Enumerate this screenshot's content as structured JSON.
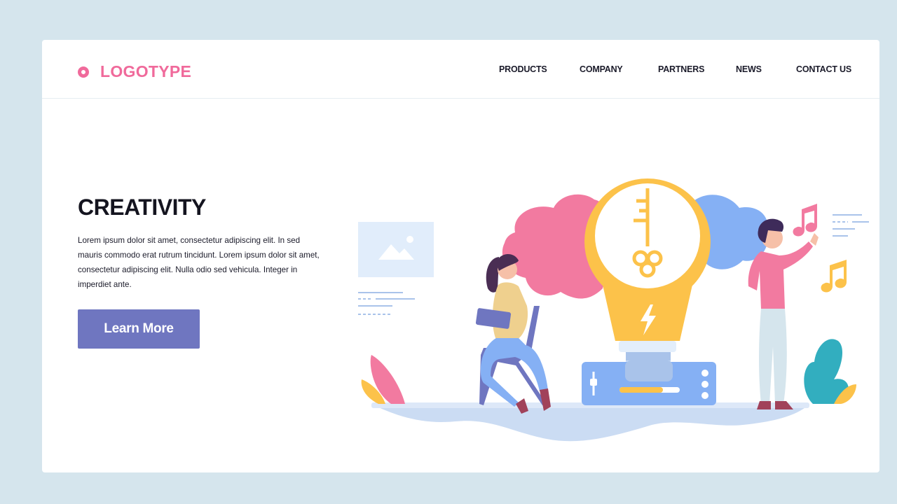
{
  "header": {
    "logo_text": "LOGOTYPE",
    "nav": [
      "PRODUCTS",
      "COMPANY",
      "PARTNERS",
      "NEWS",
      "CONTACT US"
    ]
  },
  "hero": {
    "title": "CREATIVITY",
    "body": "Lorem ipsum dolor sit amet, consectetur adipiscing elit. In sed mauris commodo erat rutrum tincidunt. Lorem ipsum dolor sit amet, consectetur adipiscing elit. Nulla  odio sed vehicula. Integer in imperdiet ante.",
    "cta_label": "Learn More"
  },
  "illustration": {
    "icons": [
      "image-placeholder-icon",
      "lightbulb-icon",
      "key-icon",
      "lightning-icon",
      "music-note-icon"
    ]
  },
  "colors": {
    "background": "#d5e5ed",
    "brand_pink": "#f06a9b",
    "button": "#6f76c0",
    "bulb_yellow": "#fcc24a",
    "accent_blue": "#85b0f4"
  }
}
